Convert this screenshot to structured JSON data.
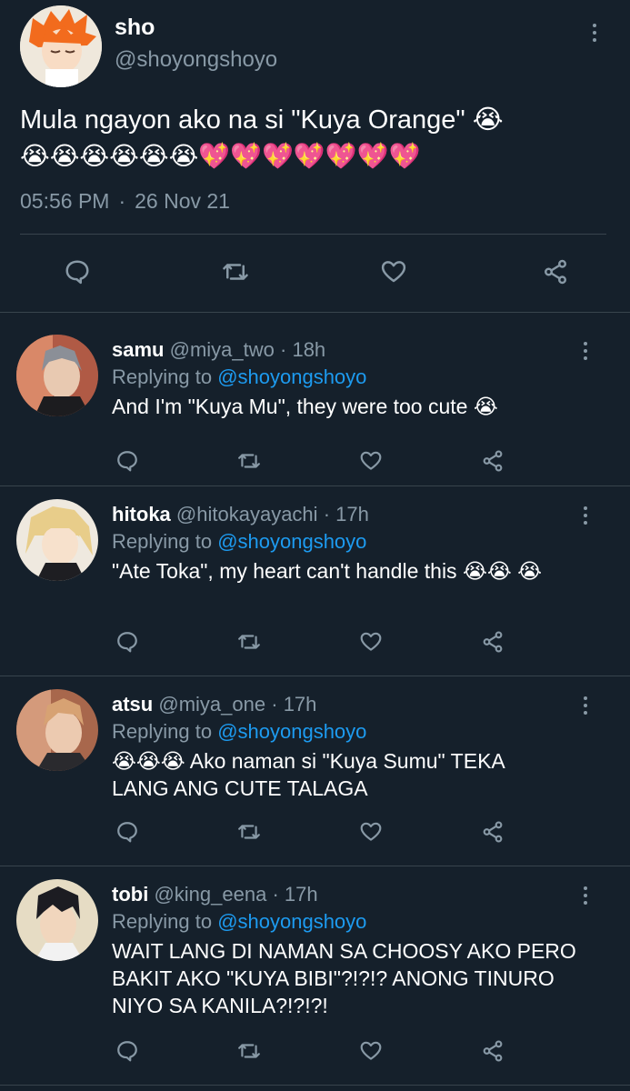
{
  "main_tweet": {
    "name": "sho",
    "handle": "@shoyongshoyo",
    "text": "Mula ngayon ako na si \"Kuya Orange\" 😭",
    "emojis": "😭😭😭😭😭😭💖💖💖💖💖💖💖",
    "time": "05:56 PM",
    "separator": "·",
    "date": "26 Nov 21"
  },
  "replies": [
    {
      "name": "samu",
      "handle": "@miya_two",
      "dot": "·",
      "time": "18h",
      "replying_prefix": "Replying to ",
      "replying_to": "@shoyongshoyo",
      "text": "And I'm \"Kuya Mu\", they were too cute 😭"
    },
    {
      "name": "hitoka",
      "handle": "@hitokayayachi",
      "dot": "·",
      "time": "17h",
      "replying_prefix": "Replying to ",
      "replying_to": "@shoyongshoyo",
      "text": "\"Ate Toka\", my heart can't handle this 😭😭 😭"
    },
    {
      "name": "atsu",
      "handle": "@miya_one",
      "dot": "·",
      "time": "17h",
      "replying_prefix": "Replying to ",
      "replying_to": "@shoyongshoyo",
      "text": "😭😭😭 Ako naman si \"Kuya Sumu\" TEKA LANG ANG CUTE TALAGA"
    },
    {
      "name": "tobi",
      "handle": "@king_eena",
      "dot": "·",
      "time": "17h",
      "replying_prefix": "Replying to ",
      "replying_to": "@shoyongshoyo",
      "text": "WAIT LANG DI NAMAN SA CHOOSY AKO PERO BAKIT AKO \"KUYA BIBI\"?!?!? ANONG TINURO NIYO SA KANILA?!?!?!"
    }
  ],
  "colors": {
    "background": "#15202b",
    "secondary_text": "#8899a6",
    "mention": "#1d9bf0",
    "divider": "#38444d"
  },
  "icons": [
    "reply-icon",
    "retweet-icon",
    "like-icon",
    "share-icon",
    "more-icon"
  ]
}
